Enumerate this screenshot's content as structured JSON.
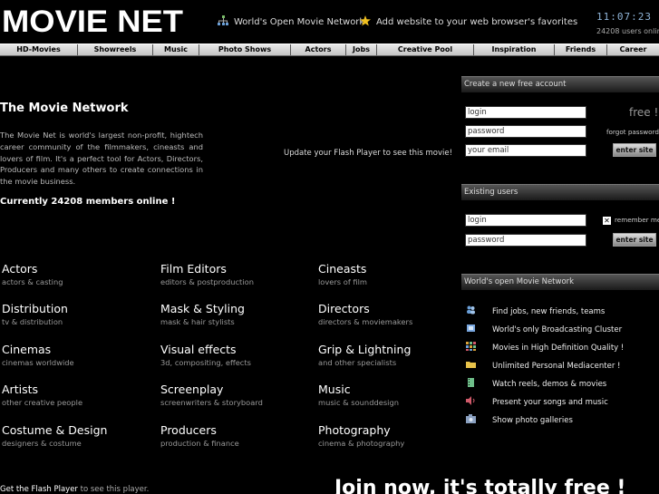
{
  "header": {
    "logo_text": "MOVIE NET",
    "link_world": "World's Open Movie Network",
    "link_favorites": "Add website to your web browser's favorites",
    "clock": "11:07:23",
    "users_online": "24208 users online"
  },
  "nav": [
    {
      "label": "HD-Movies"
    },
    {
      "label": "Showreels"
    },
    {
      "label": "Music"
    },
    {
      "label": "Photo Shows"
    },
    {
      "label": "Actors"
    },
    {
      "label": "Jobs"
    },
    {
      "label": "Creative Pool"
    },
    {
      "label": "Inspiration"
    },
    {
      "label": "Friends"
    },
    {
      "label": "Career"
    }
  ],
  "intro": {
    "title": "The Movie Network",
    "text": "The Movie Net is world's largest non-profit, hightech career community of the filmmakers, cineasts and lovers of film. It's a perfect tool for Actors, Directors, Producers and many others to create connections in the movie business.",
    "members_online": "Currently 24208 members online !",
    "flash_message": "Update your Flash Player to see this movie!"
  },
  "categories": [
    {
      "title": "Actors",
      "sub": "actors & casting"
    },
    {
      "title": "Film Editors",
      "sub": "editors & postproduction"
    },
    {
      "title": "Cineasts",
      "sub": "lovers of film"
    },
    {
      "title": "Distribution",
      "sub": "tv & distribution"
    },
    {
      "title": "Mask & Styling",
      "sub": "mask & hair stylists"
    },
    {
      "title": "Directors",
      "sub": "directors & moviemakers"
    },
    {
      "title": "Cinemas",
      "sub": "cinemas worldwide"
    },
    {
      "title": "Visual effects",
      "sub": "3d, compositing, effects"
    },
    {
      "title": "Grip & Lightning",
      "sub": "and other specialists"
    },
    {
      "title": "Artists",
      "sub": "other creative people"
    },
    {
      "title": "Screenplay",
      "sub": "screenwriters & storyboard"
    },
    {
      "title": "Music",
      "sub": "music & sounddesign"
    },
    {
      "title": "Costume & Design",
      "sub": "designers & costume"
    },
    {
      "title": "Producers",
      "sub": "production & finance"
    },
    {
      "title": "Photography",
      "sub": "cinema & photography"
    }
  ],
  "signup": {
    "heading": "Create a new free account",
    "login_value": "login",
    "password_value": "password",
    "email_value": "your email",
    "free_label": "free !",
    "forgot_password": "forgot password",
    "button": "enter site"
  },
  "existing": {
    "heading": "Existing users",
    "login_value": "login",
    "password_value": "password",
    "remember_me": "remember me",
    "button": "enter site"
  },
  "features": {
    "heading": "World's open Movie Network",
    "items": [
      {
        "label": "Find jobs, new friends, teams",
        "icon": "users-icon",
        "color": "#6a9fd8"
      },
      {
        "label": "World's only Broadcasting Cluster",
        "icon": "broadcast-icon",
        "color": "#7aa8e0"
      },
      {
        "label": "Movies in High Definition Quality !",
        "icon": "grid-icon",
        "color": "#d9a23a"
      },
      {
        "label": "Unlimited Personal Mediacenter !",
        "icon": "folder-icon",
        "color": "#e8c24a"
      },
      {
        "label": "Watch reels, demos & movies",
        "icon": "film-icon",
        "color": "#6fbf8a"
      },
      {
        "label": "Present your songs and music",
        "icon": "speaker-icon",
        "color": "#d05a6a"
      },
      {
        "label": "Show photo galleries",
        "icon": "camera-icon",
        "color": "#8aa0c0"
      }
    ]
  },
  "footer": {
    "get_flash_link": "Get the Flash Player",
    "get_flash_rest": "to see this player.",
    "join_banner": "Join now, it's totally free !"
  }
}
